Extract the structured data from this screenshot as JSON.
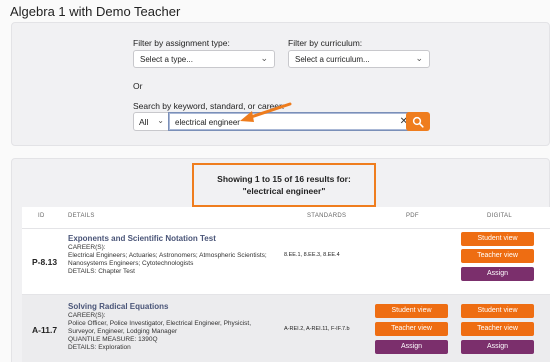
{
  "page": {
    "title": "Algebra 1 with Demo Teacher"
  },
  "filters": {
    "assignment_type_label": "Filter by assignment type:",
    "assignment_type_value": "Select a type...",
    "curriculum_label": "Filter by curriculum:",
    "curriculum_value": "Select a curriculum...",
    "or_label": "Or",
    "search_label": "Search by keyword, standard, or career:",
    "scope_value": "All",
    "search_value": "electrical engineer",
    "clear_glyph": "✕"
  },
  "results": {
    "summary": "Showing 1 to 15 of 16 results for: \"electrical engineer\"",
    "columns": {
      "id": "ID",
      "details": "DETAILS",
      "standards": "STANDARDS",
      "pdf": "PDF",
      "digital": "DIGITAL"
    },
    "rows": [
      {
        "id": "P-8.13",
        "title": "Exponents and Scientific Notation Test",
        "careers_label": "CAREER(S):",
        "careers_1": "Electrical Engineers; Actuaries; Astronomers; Atmospheric Scientists;",
        "careers_2": "Nanosystems Engineers; Cytotechnologists",
        "details": "DETAILS: Chapter Test",
        "standards": "8.EE.1, 8.EE.3, 8.EE.4",
        "digital_student": "Student view",
        "digital_teacher": "Teacher view",
        "digital_assign": "Assign"
      },
      {
        "id": "A-11.7",
        "title": "Solving Radical Equations",
        "careers_label": "CAREER(S):",
        "careers_1": "Police Officer, Police Investigator, Electrical Engineer, Physicist,",
        "careers_2": "Surveyor, Engineer, Lodging Manager",
        "quantile": "QUANTILE MEASURE: 1390Q",
        "details": "DETAILS: Exploration",
        "standards": "A-REI.2, A-REI.11, F-IF.7.b",
        "pdf_student": "Student view",
        "pdf_teacher": "Teacher view",
        "pdf_assign": "Assign",
        "digital_student": "Student view",
        "digital_teacher": "Teacher view",
        "digital_assign": "Assign"
      }
    ]
  },
  "colors": {
    "accent_orange": "#ef7d1e",
    "assign_purple": "#7b2f6c"
  },
  "icons": {
    "search": "search-icon",
    "chevron": "chevron-down-icon",
    "clear": "close-icon",
    "annotation": "arrow-annotation"
  }
}
